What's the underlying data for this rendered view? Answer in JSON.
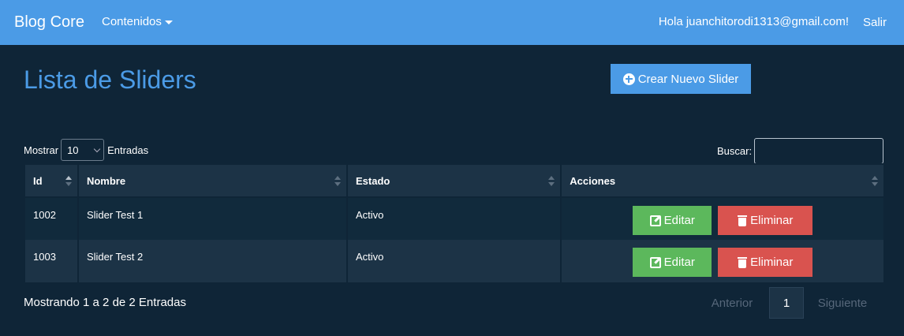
{
  "navbar": {
    "brand": "Blog Core",
    "menu_label": "Contenidos",
    "greeting": "Hola juanchitorodi1313@gmail.com!",
    "logout": "Salir"
  },
  "header": {
    "title": "Lista de Sliders",
    "create_button": "Crear Nuevo Slider"
  },
  "controls": {
    "show_label": "Mostrar",
    "page_length": "10",
    "entries_label": "Entradas",
    "search_label": "Buscar:",
    "search_value": ""
  },
  "table": {
    "columns": [
      "Id",
      "Nombre",
      "Estado",
      "Acciones"
    ],
    "rows": [
      {
        "id": "1002",
        "name": "Slider Test 1",
        "status": "Activo",
        "edit": "Editar",
        "delete": "Eliminar"
      },
      {
        "id": "1003",
        "name": "Slider Test 2",
        "status": "Activo",
        "edit": "Editar",
        "delete": "Eliminar"
      }
    ]
  },
  "footer": {
    "info": "Mostrando 1 a 2 de 2 Entradas",
    "prev": "Anterior",
    "page": "1",
    "next": "Siguiente"
  },
  "colors": {
    "navbar": "#4b9be6",
    "background": "#0f2537",
    "edit": "#5cb85c",
    "delete": "#d9534f"
  }
}
